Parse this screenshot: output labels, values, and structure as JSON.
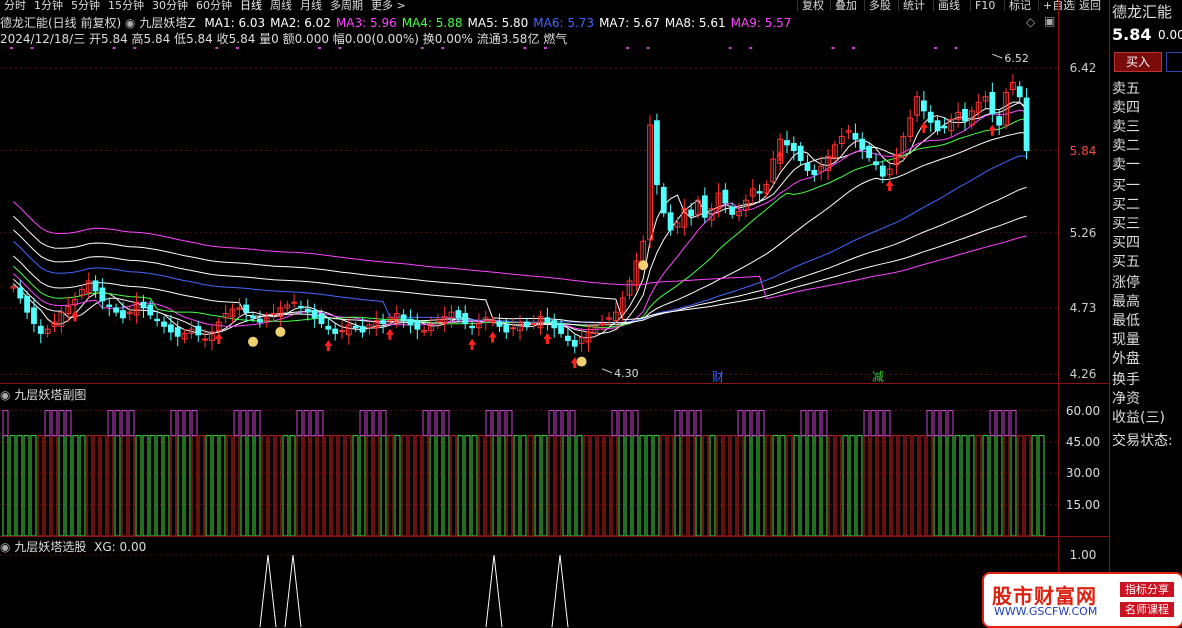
{
  "toolbar": {
    "timeframes": [
      "分时",
      "1分钟",
      "5分钟",
      "15分钟",
      "30分钟",
      "60分钟",
      "日线",
      "周线",
      "月线",
      "多周期",
      "更多 >"
    ],
    "active": "日线",
    "buttons": [
      "复权",
      "叠加",
      "多股",
      "统计",
      "画线",
      "F10",
      "标记",
      "+自选",
      "返回"
    ]
  },
  "main_info": {
    "title": "德龙汇能(日线 前复权)",
    "indicator": "九层妖塔Z",
    "ma": [
      {
        "label": "MA1: 6.03",
        "color": "#ffffff"
      },
      {
        "label": "MA2: 6.02",
        "color": "#ffffff"
      },
      {
        "label": "MA3: 5.96",
        "color": "#ff44ff"
      },
      {
        "label": "MA4: 5.88",
        "color": "#44ff44"
      },
      {
        "label": "MA5: 5.80",
        "color": "#ffffff"
      },
      {
        "label": "MA6: 5.73",
        "color": "#4466ff"
      },
      {
        "label": "MA7: 5.67",
        "color": "#ffffff"
      },
      {
        "label": "MA8: 5.61",
        "color": "#ffffff"
      },
      {
        "label": "MA9: 5.57",
        "color": "#ff44ff"
      }
    ],
    "quote": "2024/12/18/三  开5.84 高5.84 低5.84 收5.84 量0 额0.000 幅0.00(0.00%) 换0.00% 流通3.58亿 燃气",
    "y_labels": [
      "6.42",
      "5.84",
      "5.26",
      "4.73",
      "4.26"
    ],
    "y_label_colors": [
      "#cccccc",
      "#ff4444",
      "#cccccc",
      "#cccccc",
      "#cccccc"
    ],
    "high_label": "6.52",
    "low_label": "4.30",
    "badges": [
      "财",
      "减"
    ],
    "badge_colors": [
      "#3366ff",
      "#33cc33"
    ]
  },
  "sub1": {
    "title": "九层妖塔副图",
    "y_labels": [
      "60.00",
      "45.00",
      "30.00",
      "15.00"
    ]
  },
  "sub2": {
    "title": "九层妖塔选股",
    "value": "XG: 0.00",
    "y_labels": [
      "1.00"
    ]
  },
  "right_panel": {
    "name": "德龙汇能",
    "price": "5.84",
    "change": "0.00",
    "buy": "买入",
    "asks": [
      "卖五",
      "卖四",
      "卖三",
      "卖二",
      "卖一"
    ],
    "bids": [
      "买一",
      "买二",
      "买三",
      "买四",
      "买五"
    ],
    "stats": [
      "涨停",
      "最高",
      "最低",
      "现量",
      "外盘"
    ],
    "extra": [
      "换手",
      "净资",
      "收益(三)"
    ],
    "status": "交易状态:"
  },
  "watermark": {
    "title": "股市财富网",
    "url": "WWW.GSCFW.COM",
    "tag1": "指标分享",
    "tag2": "名师课程"
  },
  "chart_data": {
    "type": "candlestick",
    "y_ticks": [
      6.42,
      5.84,
      5.26,
      4.73,
      4.26
    ],
    "annotations": {
      "high": 6.52,
      "low": 4.3
    },
    "closes": [
      4.88,
      4.8,
      4.7,
      4.62,
      4.55,
      4.58,
      4.63,
      4.7,
      4.74,
      4.79,
      4.86,
      4.92,
      4.85,
      4.78,
      4.74,
      4.7,
      4.66,
      4.7,
      4.77,
      4.73,
      4.68,
      4.64,
      4.6,
      4.56,
      4.53,
      4.55,
      4.58,
      4.54,
      4.51,
      4.56,
      4.63,
      4.69,
      4.72,
      4.73,
      4.7,
      4.66,
      4.63,
      4.66,
      4.69,
      4.73,
      4.75,
      4.77,
      4.73,
      4.7,
      4.66,
      4.62,
      4.58,
      4.55,
      4.57,
      4.61,
      4.59,
      4.56,
      4.61,
      4.64,
      4.62,
      4.66,
      4.69,
      4.64,
      4.61,
      4.58,
      4.57,
      4.61,
      4.65,
      4.67,
      4.7,
      4.66,
      4.62,
      4.59,
      4.62,
      4.66,
      4.64,
      4.6,
      4.56,
      4.59,
      4.63,
      4.6,
      4.62,
      4.67,
      4.63,
      4.59,
      4.55,
      4.5,
      4.46,
      4.52,
      4.56,
      4.6,
      4.62,
      4.66,
      4.7,
      4.8,
      4.92,
      5.06,
      5.2,
      6.02,
      5.6,
      5.4,
      5.28,
      5.33,
      5.43,
      5.38,
      5.49,
      5.37,
      5.43,
      5.54,
      5.47,
      5.39,
      5.41,
      5.49,
      5.57,
      5.54,
      5.6,
      5.78,
      5.92,
      5.88,
      5.84,
      5.77,
      5.7,
      5.67,
      5.73,
      5.8,
      5.88,
      5.94,
      5.98,
      5.92,
      5.85,
      5.79,
      5.74,
      5.66,
      5.71,
      5.81,
      5.94,
      6.07,
      6.22,
      6.12,
      6.04,
      5.98,
      6.0,
      6.06,
      6.11,
      6.05,
      6.12,
      6.18,
      6.22,
      6.1,
      6.02,
      6.25,
      6.32,
      6.22,
      5.84
    ]
  }
}
